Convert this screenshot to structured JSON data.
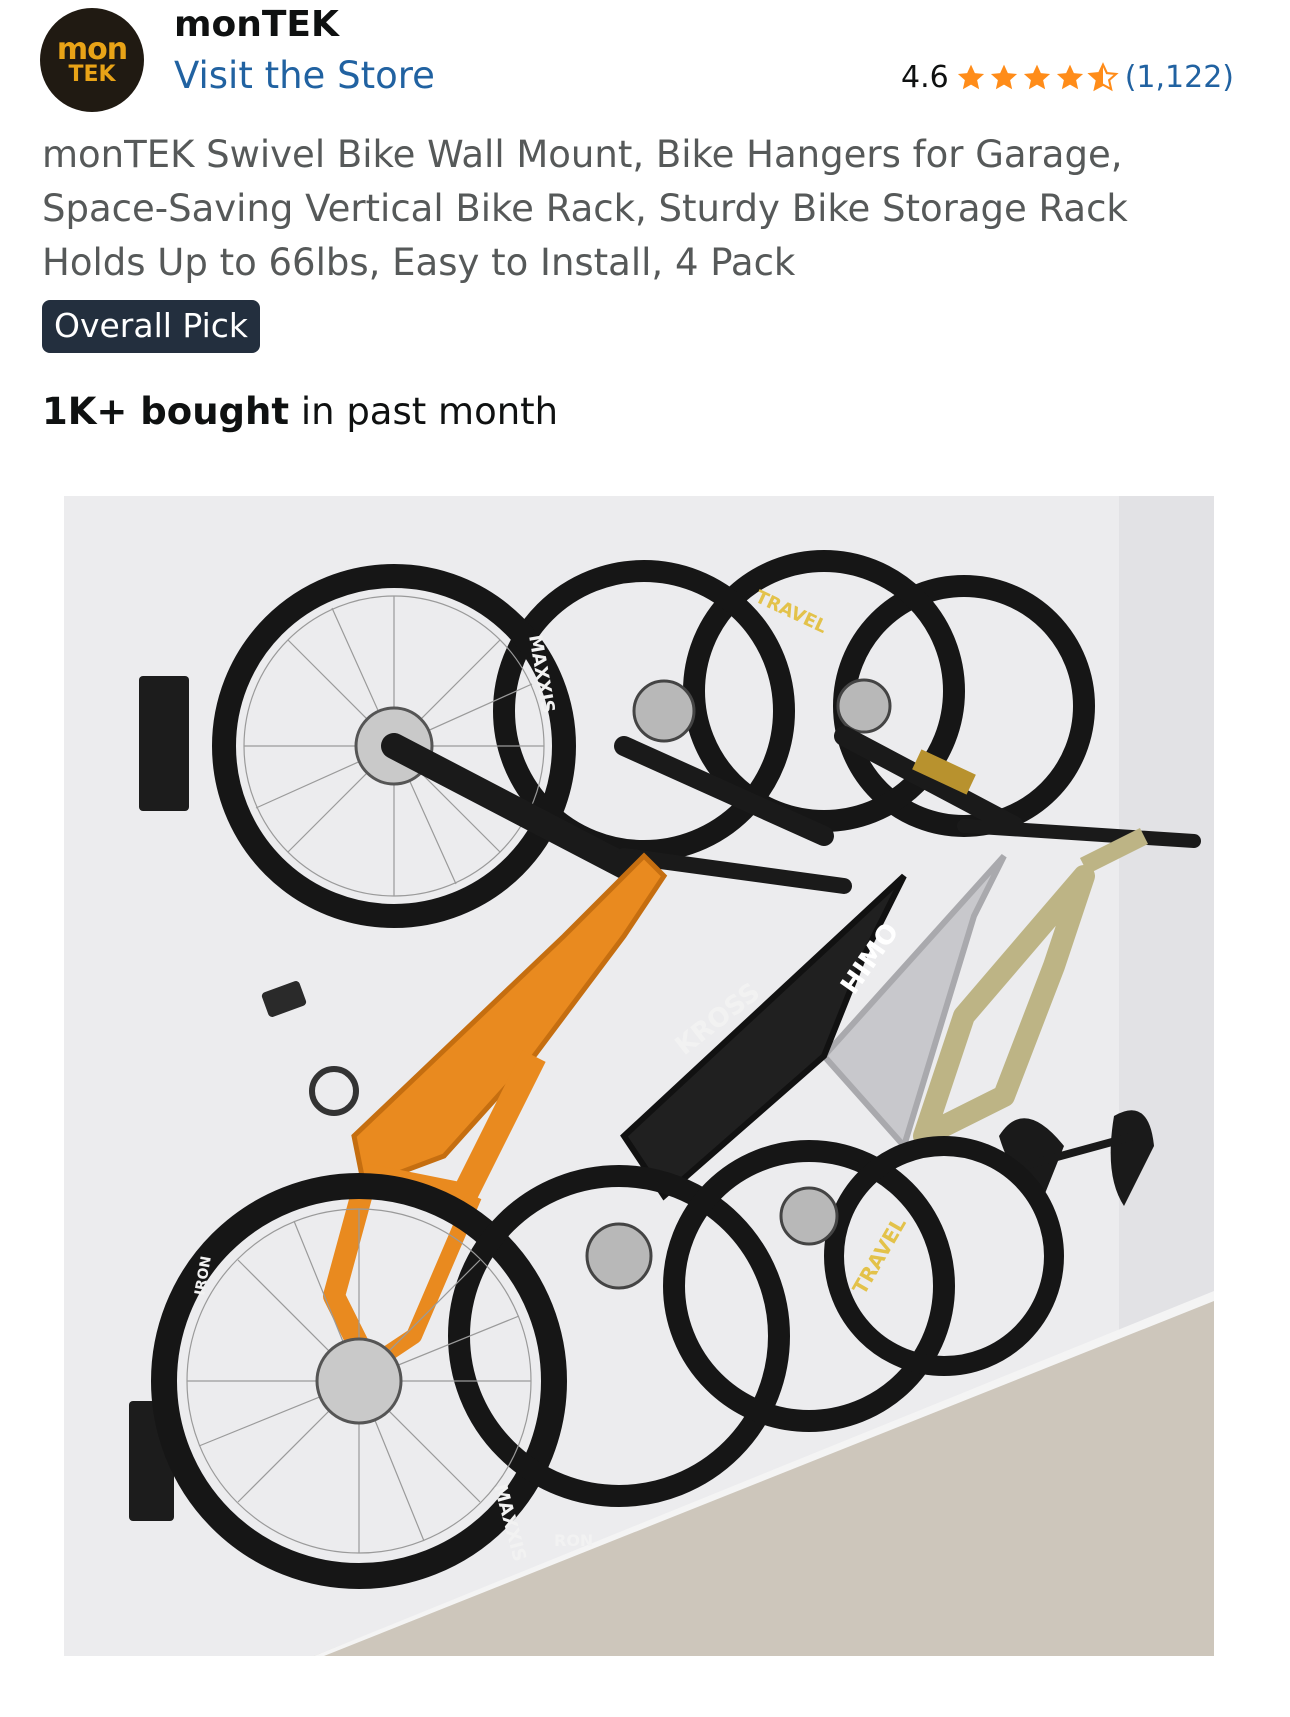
{
  "store": {
    "logo_line1": "mon",
    "logo_line2": "TEK",
    "name": "monTEK",
    "link_label": "Visit the Store"
  },
  "rating": {
    "value": "4.6",
    "stars": 4.5,
    "stars_out_of": 5,
    "review_count": "(1,122)"
  },
  "product": {
    "title": "monTEK Swivel Bike Wall Mount, Bike Hangers for Garage, Space-Saving Vertical Bike Rack, Sturdy Bike Storage Rack Holds Up to 66lbs, Easy to Install, 4 Pack",
    "badge": "Overall Pick",
    "bought_bold": "1K+ bought",
    "bought_rest": " in past month"
  },
  "colors": {
    "link": "#2162a1",
    "star": "#ff8c19",
    "badge_bg": "#232f3e",
    "title_text": "#565959",
    "logo_bg": "#201a12",
    "logo_text": "#e8a317"
  },
  "image": {
    "tire_labels": [
      "MAXXIS",
      "TRAVEL",
      "IRON",
      "MAXXIS",
      "RON"
    ],
    "frame_labels": [
      "KROSS",
      "HIMO",
      "TRAVEL"
    ]
  }
}
